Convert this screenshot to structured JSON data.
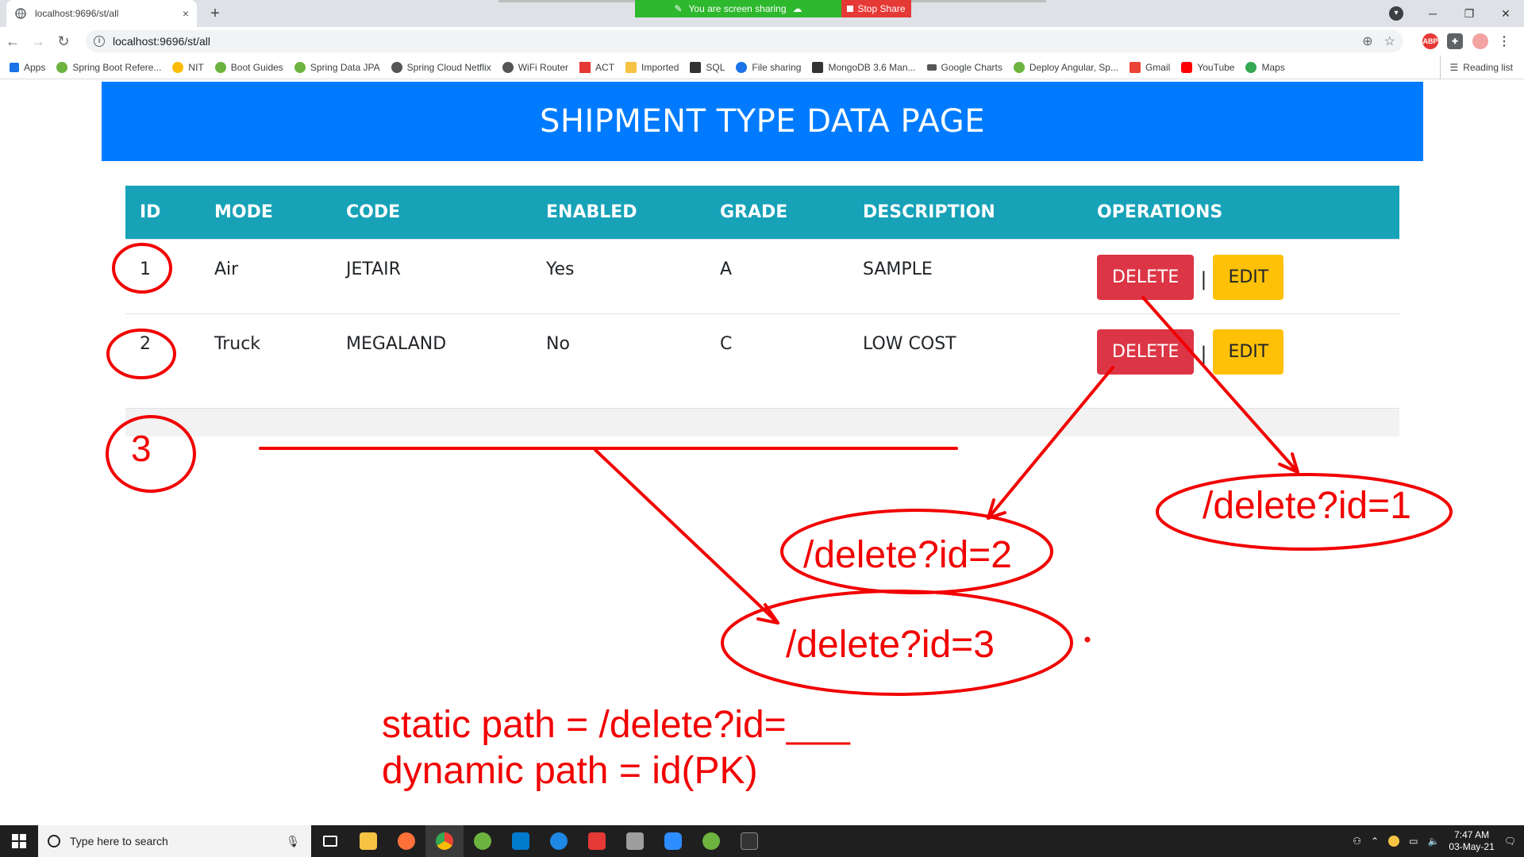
{
  "browser": {
    "tab_title": "localhost:9696/st/all",
    "tab_close": "×",
    "new_tab": "+",
    "sharing_text": "You are screen sharing",
    "stop_share": "Stop Share",
    "url": "localhost:9696/st/all",
    "bookmarks": [
      {
        "label": "Apps",
        "color": "#1a73e8"
      },
      {
        "label": "Spring Boot Refere...",
        "color": "#6db33f"
      },
      {
        "label": "NIT",
        "color": "#fbbc04"
      },
      {
        "label": "Boot Guides",
        "color": "#6db33f"
      },
      {
        "label": "Spring Data JPA",
        "color": "#6db33f"
      },
      {
        "label": "Spring Cloud Netflix",
        "color": "#555555"
      },
      {
        "label": "WiFi Router",
        "color": "#555555"
      },
      {
        "label": "ACT",
        "color": "#e53935"
      },
      {
        "label": "Imported",
        "color": "#f6c343"
      },
      {
        "label": "SQL",
        "color": "#333333"
      },
      {
        "label": "File sharing",
        "color": "#1a73e8"
      },
      {
        "label": "MongoDB 3.6 Man...",
        "color": "#333333"
      },
      {
        "label": "Google Charts",
        "color": "#555555"
      },
      {
        "label": "Deploy Angular, Sp...",
        "color": "#6db33f"
      },
      {
        "label": "Gmail",
        "color": "#ea4335"
      },
      {
        "label": "YouTube",
        "color": "#ff0000"
      },
      {
        "label": "Maps",
        "color": "#34a853"
      }
    ],
    "reading_list": "Reading list"
  },
  "page": {
    "title": "SHIPMENT TYPE DATA PAGE",
    "columns": [
      "ID",
      "MODE",
      "CODE",
      "ENABLED",
      "GRADE",
      "DESCRIPTION",
      "OPERATIONS"
    ],
    "rows": [
      {
        "id": "1",
        "mode": "Air",
        "code": "JETAIR",
        "enabled": "Yes",
        "grade": "A",
        "description": "SAMPLE"
      },
      {
        "id": "2",
        "mode": "Truck",
        "code": "MEGALAND",
        "enabled": "No",
        "grade": "C",
        "description": "LOW COST"
      }
    ],
    "delete_label": "DELETE",
    "edit_label": "EDIT",
    "separator": "|"
  },
  "annotations": {
    "circled_3": "3",
    "delete_1": "/delete?id=1",
    "delete_2": "/delete?id=2",
    "delete_3": "/delete?id=3",
    "static_path": "static path = /delete?id=___",
    "dynamic_path": "dynamic path = id(PK)",
    "color": "#f20000"
  },
  "taskbar": {
    "search_placeholder": "Type here to search",
    "time": "7:47 AM",
    "date": "03-May-21"
  }
}
